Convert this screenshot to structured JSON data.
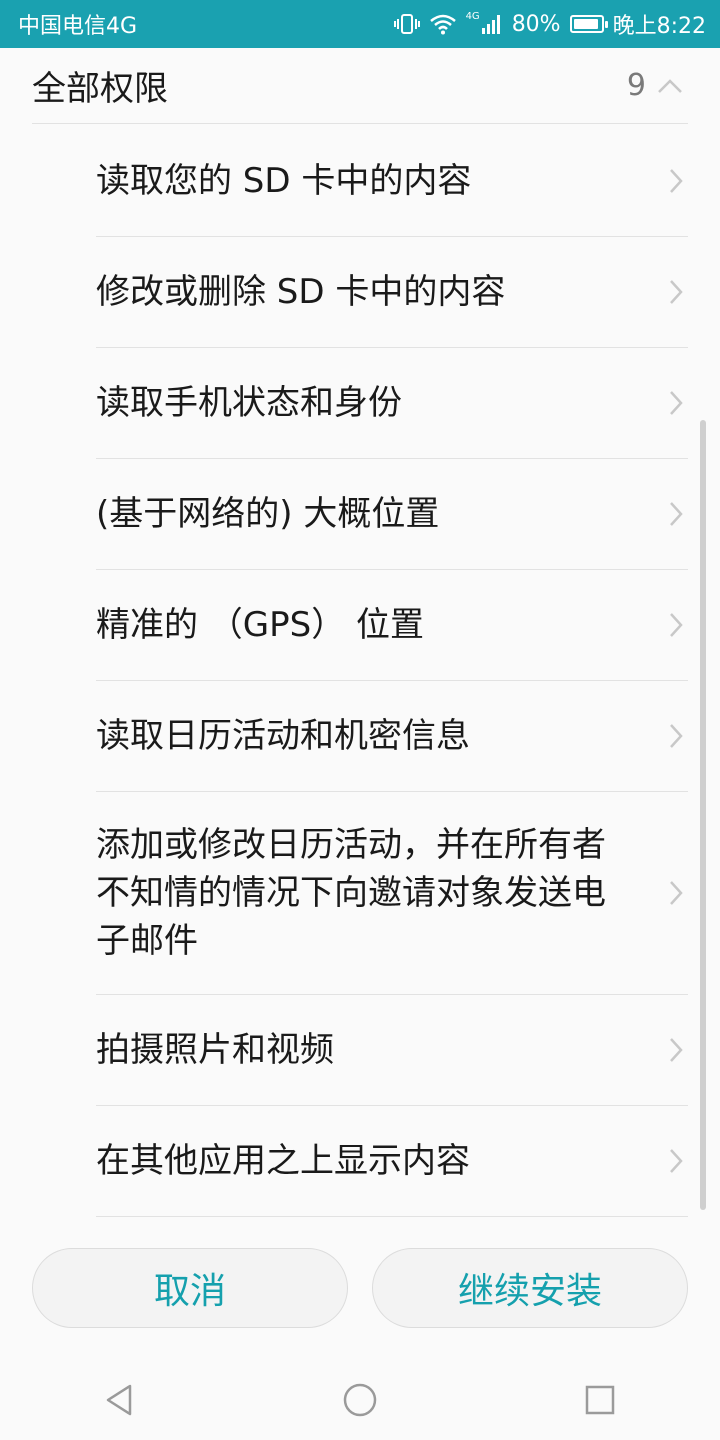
{
  "status_bar": {
    "carrier": "中国电信4G",
    "network_badge": "4G",
    "battery": "80%",
    "time": "晚上8:22",
    "icons": [
      "vibrate-icon",
      "wifi-icon",
      "signal-icon",
      "battery-icon"
    ]
  },
  "permissions": {
    "title": "全部权限",
    "count": "9",
    "items": [
      {
        "label": "读取您的 SD 卡中的内容"
      },
      {
        "label": "修改或删除 SD 卡中的内容"
      },
      {
        "label": "读取手机状态和身份"
      },
      {
        "label": "(基于网络的) 大概位置"
      },
      {
        "label": "精准的 （GPS） 位置"
      },
      {
        "label": "读取日历活动和机密信息"
      },
      {
        "label": "添加或修改日历活动，并在所有者不知情的情况下向邀请对象发送电子邮件"
      },
      {
        "label": "拍摄照片和视频"
      },
      {
        "label": "在其他应用之上显示内容"
      }
    ]
  },
  "buttons": {
    "cancel": "取消",
    "continue": "继续安装"
  },
  "colors": {
    "status_bar": "#1aa1b0",
    "accent": "#15a0ad"
  }
}
